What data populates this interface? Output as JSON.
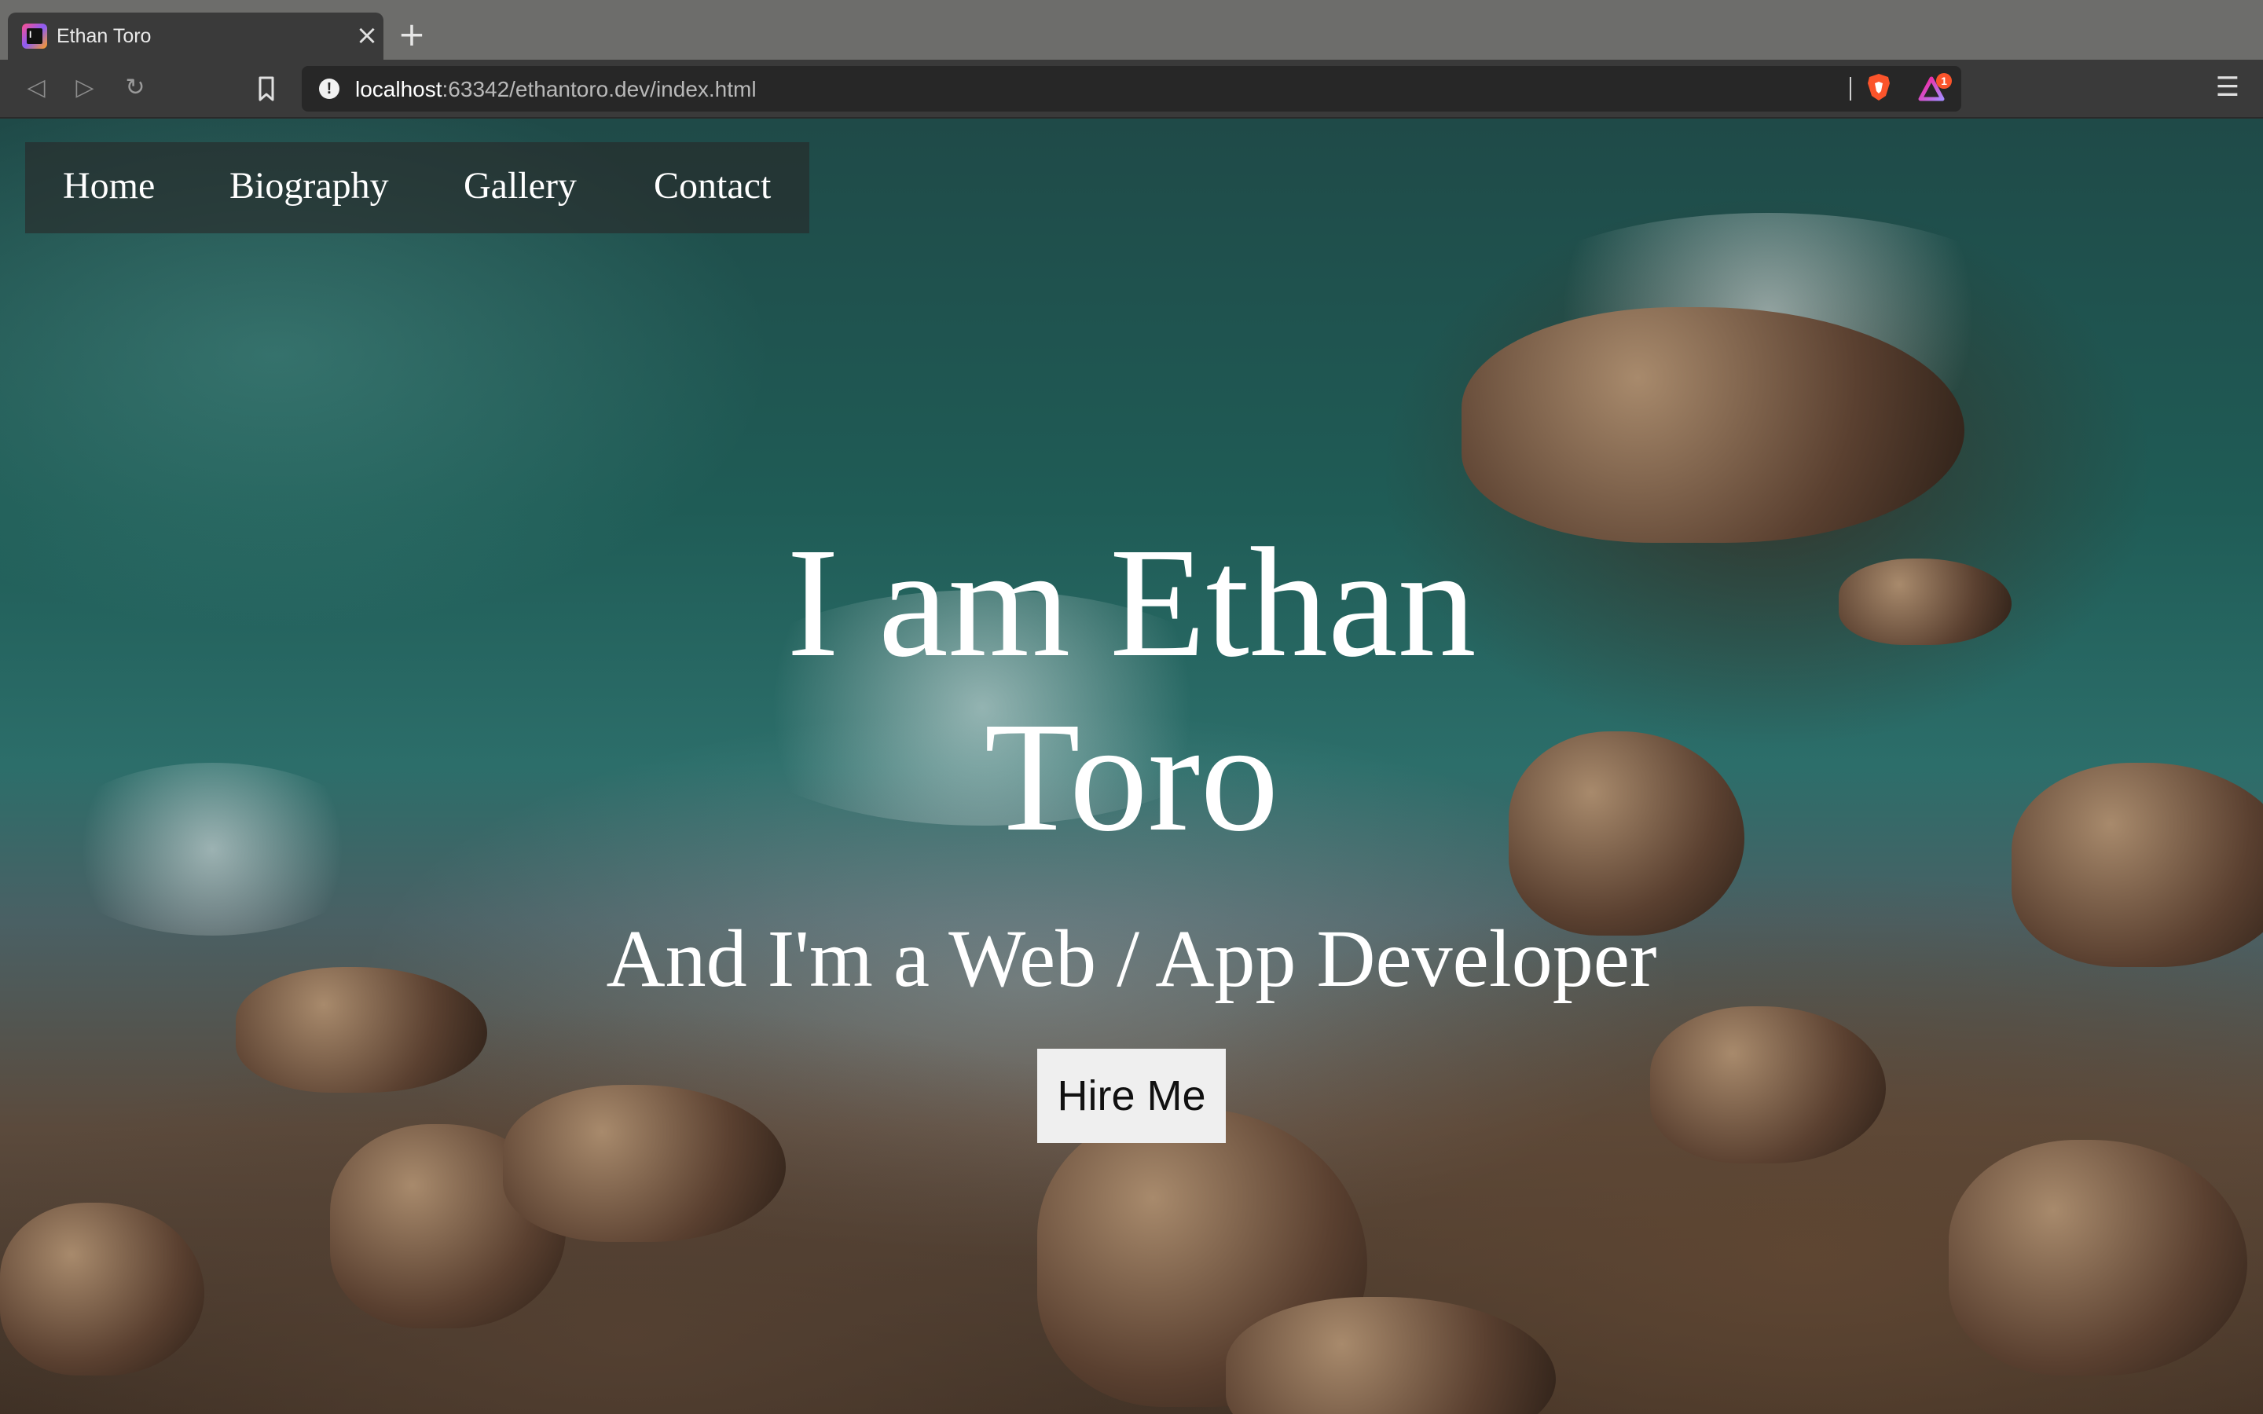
{
  "browser": {
    "tab": {
      "title": "Ethan Toro",
      "favicon_icon": "webstorm-icon",
      "favicon_glyph": "I"
    },
    "new_tab_glyph": "+",
    "close_glyph": "×",
    "toolbar": {
      "back_glyph": "◁",
      "forward_glyph": "▷",
      "reload_glyph": "↻",
      "menu_glyph": "☰"
    },
    "address": {
      "host": "localhost",
      "rest": ":63342/ethantoro.dev/index.html",
      "info_glyph": "!"
    },
    "rewards_badge": "1"
  },
  "page": {
    "nav": {
      "items": [
        {
          "label": "Home"
        },
        {
          "label": "Biography"
        },
        {
          "label": "Gallery"
        },
        {
          "label": "Contact"
        }
      ]
    },
    "hero": {
      "title_line1": "I am Ethan",
      "title_line2": "Toro",
      "subtitle": "And I'm a Web / App Developer",
      "cta_label": "Hire Me"
    }
  },
  "colors": {
    "tabstrip": "#6d6d6b",
    "toolbar": "#3a3a3a",
    "urlbar": "#272727",
    "brave_orange": "#fb542b",
    "hero_text": "#ffffff",
    "button_bg": "#efefef"
  }
}
